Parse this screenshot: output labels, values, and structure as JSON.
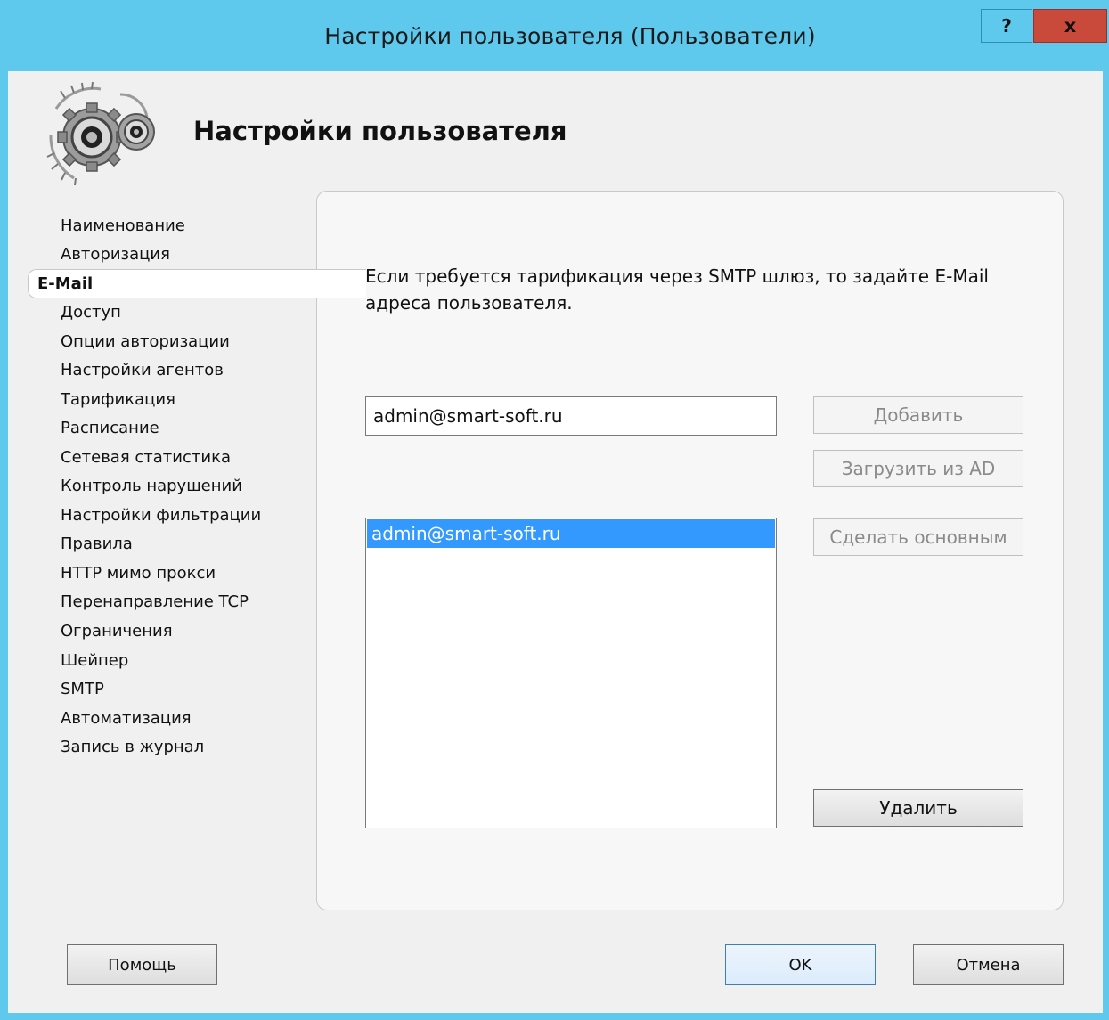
{
  "window": {
    "title": "Настройки пользователя (Пользователи)",
    "help_glyph": "?",
    "close_glyph": "x"
  },
  "header": {
    "title": "Настройки пользователя",
    "logo_icon": "gears-icon"
  },
  "nav": {
    "items": [
      {
        "label": "Наименование"
      },
      {
        "label": "Авторизация"
      },
      {
        "label": "E-Mail",
        "active": true
      },
      {
        "label": "Доступ"
      },
      {
        "label": "Опции авторизации"
      },
      {
        "label": "Настройки агентов"
      },
      {
        "label": "Тарификация"
      },
      {
        "label": "Расписание"
      },
      {
        "label": "Сетевая статистика"
      },
      {
        "label": "Контроль нарушений"
      },
      {
        "label": "Настройки фильтрации"
      },
      {
        "label": "Правила"
      },
      {
        "label": "HTTP мимо прокси"
      },
      {
        "label": "Перенаправление TCP"
      },
      {
        "label": "Ограничения"
      },
      {
        "label": "Шейпер"
      },
      {
        "label": "SMTP"
      },
      {
        "label": "Автоматизация"
      },
      {
        "label": "Запись в журнал"
      }
    ]
  },
  "email_panel": {
    "description": "Если требуется тарификация через SMTP шлюз, то задайте E-Mail адреса пользователя.",
    "input_value": "admin@smart-soft.ru",
    "list_items": [
      "admin@smart-soft.ru"
    ],
    "add_label": "Добавить",
    "load_ad_label": "Загрузить из AD",
    "make_main_label": "Сделать основным",
    "delete_label": "Удалить"
  },
  "footer": {
    "help_label": "Помощь",
    "ok_label": "OK",
    "cancel_label": "Отмена"
  },
  "colors": {
    "titlebar": "#5ec9ec",
    "close": "#c9493b",
    "selection": "#3399ff"
  }
}
